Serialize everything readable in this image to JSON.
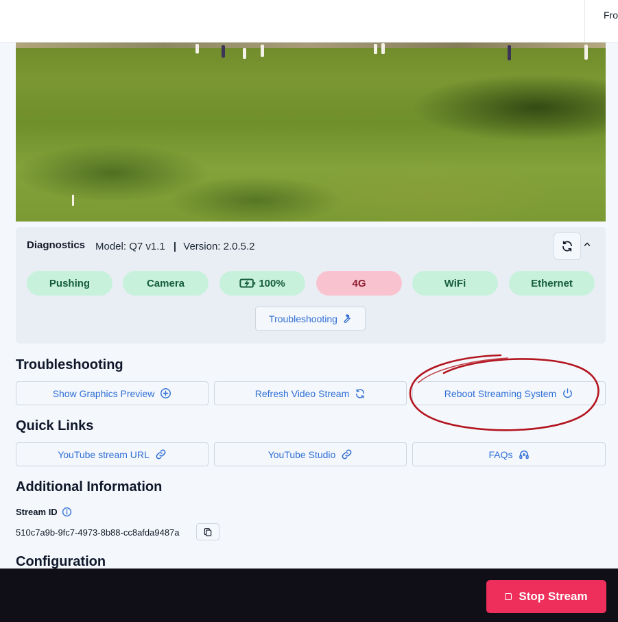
{
  "topbar": {
    "text": "Fro"
  },
  "diagnostics": {
    "title": "Diagnostics",
    "model_text": "Model: Q7 v1.1",
    "separator": "|",
    "version_text": "Version: 2.0.5.2",
    "pills": [
      {
        "label": "Pushing",
        "status": "ok"
      },
      {
        "label": "Camera",
        "status": "ok"
      },
      {
        "label": "100%",
        "status": "ok",
        "icon": "battery-charging-icon"
      },
      {
        "label": "4G",
        "status": "bad"
      },
      {
        "label": "WiFi",
        "status": "ok"
      },
      {
        "label": "Ethernet",
        "status": "ok"
      }
    ],
    "troubleshooting_button": "Troubleshooting"
  },
  "troubleshooting": {
    "heading": "Troubleshooting",
    "buttons": [
      {
        "label": "Show Graphics Preview",
        "icon": "plus-circle-icon"
      },
      {
        "label": "Refresh Video Stream",
        "icon": "refresh-icon"
      },
      {
        "label": "Reboot Streaming System",
        "icon": "power-icon"
      }
    ]
  },
  "quick_links": {
    "heading": "Quick Links",
    "buttons": [
      {
        "label": "YouTube stream URL",
        "icon": "link-icon"
      },
      {
        "label": "YouTube Studio",
        "icon": "link-icon"
      },
      {
        "label": "FAQs",
        "icon": "headset-icon"
      }
    ]
  },
  "additional_info": {
    "heading": "Additional Information",
    "stream_id_label": "Stream ID",
    "stream_id_value": "510c7a9b-9fc7-4973-8b88-cc8afda9487a"
  },
  "configuration": {
    "heading": "Configuration"
  },
  "bottom_bar": {
    "stop_label": "Stop Stream"
  },
  "colors": {
    "accent_blue": "#2f6fd6",
    "ok_pill_bg": "#c8f1dc",
    "bad_pill_bg": "#f8c3cf",
    "stop_button": "#ee2e5b",
    "annotation_circle": "#b3151f"
  }
}
